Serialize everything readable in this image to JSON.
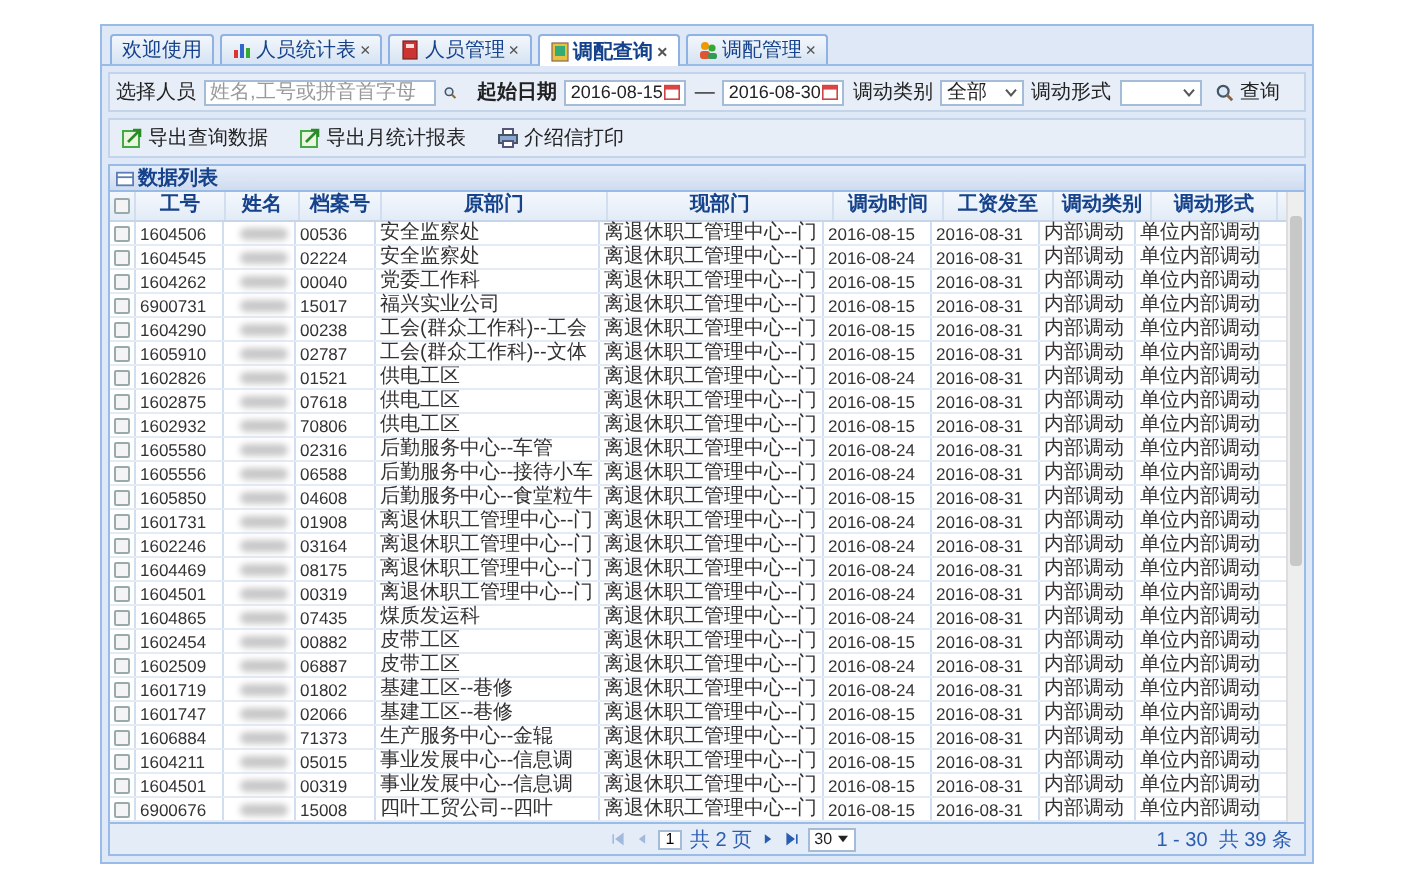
{
  "tabs": [
    {
      "label": "欢迎使用",
      "selected": false
    },
    {
      "label": "人员统计表",
      "close": "×",
      "selected": false
    },
    {
      "label": "人员管理",
      "close": "×",
      "selected": false
    },
    {
      "label": "调配查询",
      "close": "×",
      "selected": true
    },
    {
      "label": "调配管理",
      "close": "×",
      "selected": false
    }
  ],
  "filters": {
    "person_label": "选择人员",
    "person_placeholder": "姓名,工号或拼音首字母",
    "start_label": "起始日期",
    "start_date": "2016-08-15",
    "separator": "—",
    "end_date": "2016-08-30",
    "type_label": "调动类别",
    "type_value": "全部",
    "form_label": "调动形式",
    "query_button": "查询"
  },
  "actions": [
    {
      "label": "导出查询数据"
    },
    {
      "label": "导出月统计报表"
    },
    {
      "label": "介绍信打印"
    }
  ],
  "panel_title": "数据列表",
  "table": {
    "header_checked": false,
    "columns": [
      "工号",
      "姓名",
      "档案号",
      "原部门",
      "现部门",
      "调动时间",
      "工资发至",
      "调动类别",
      "调动形式"
    ],
    "rows": [
      {
        "checked": false,
        "cells": [
          "1604506",
          "",
          "00536",
          "安全监察处",
          "离退休职工管理中心--门",
          "2016-08-15",
          "2016-08-31",
          "内部调动",
          "单位内部调动"
        ]
      },
      {
        "checked": false,
        "cells": [
          "1604545",
          "",
          "02224",
          "安全监察处",
          "离退休职工管理中心--门",
          "2016-08-24",
          "2016-08-31",
          "内部调动",
          "单位内部调动"
        ]
      },
      {
        "checked": false,
        "cells": [
          "1604262",
          "",
          "00040",
          "党委工作科",
          "离退休职工管理中心--门",
          "2016-08-15",
          "2016-08-31",
          "内部调动",
          "单位内部调动"
        ]
      },
      {
        "checked": false,
        "cells": [
          "6900731",
          "",
          "15017",
          "福兴实业公司",
          "离退休职工管理中心--门",
          "2016-08-15",
          "2016-08-31",
          "内部调动",
          "单位内部调动"
        ]
      },
      {
        "checked": false,
        "cells": [
          "1604290",
          "",
          "00238",
          "工会(群众工作科)--工会",
          "离退休职工管理中心--门",
          "2016-08-15",
          "2016-08-31",
          "内部调动",
          "单位内部调动"
        ]
      },
      {
        "checked": false,
        "cells": [
          "1605910",
          "",
          "02787",
          "工会(群众工作科)--文体",
          "离退休职工管理中心--门",
          "2016-08-15",
          "2016-08-31",
          "内部调动",
          "单位内部调动"
        ]
      },
      {
        "checked": false,
        "cells": [
          "1602826",
          "",
          "01521",
          "供电工区",
          "离退休职工管理中心--门",
          "2016-08-24",
          "2016-08-31",
          "内部调动",
          "单位内部调动"
        ]
      },
      {
        "checked": false,
        "cells": [
          "1602875",
          "",
          "07618",
          "供电工区",
          "离退休职工管理中心--门",
          "2016-08-15",
          "2016-08-31",
          "内部调动",
          "单位内部调动"
        ]
      },
      {
        "checked": false,
        "cells": [
          "1602932",
          "",
          "70806",
          "供电工区",
          "离退休职工管理中心--门",
          "2016-08-15",
          "2016-08-31",
          "内部调动",
          "单位内部调动"
        ]
      },
      {
        "checked": false,
        "cells": [
          "1605580",
          "",
          "02316",
          "后勤服务中心--车管",
          "离退休职工管理中心--门",
          "2016-08-24",
          "2016-08-31",
          "内部调动",
          "单位内部调动"
        ]
      },
      {
        "checked": false,
        "cells": [
          "1605556",
          "",
          "06588",
          "后勤服务中心--接待小车",
          "离退休职工管理中心--门",
          "2016-08-24",
          "2016-08-31",
          "内部调动",
          "单位内部调动"
        ]
      },
      {
        "checked": false,
        "cells": [
          "1605850",
          "",
          "04608",
          "后勤服务中心--食堂粒牛",
          "离退休职工管理中心--门",
          "2016-08-15",
          "2016-08-31",
          "内部调动",
          "单位内部调动"
        ]
      },
      {
        "checked": false,
        "cells": [
          "1601731",
          "",
          "01908",
          "离退休职工管理中心--门",
          "离退休职工管理中心--门",
          "2016-08-24",
          "2016-08-31",
          "内部调动",
          "单位内部调动"
        ]
      },
      {
        "checked": false,
        "cells": [
          "1602246",
          "",
          "03164",
          "离退休职工管理中心--门",
          "离退休职工管理中心--门",
          "2016-08-24",
          "2016-08-31",
          "内部调动",
          "单位内部调动"
        ]
      },
      {
        "checked": false,
        "cells": [
          "1604469",
          "",
          "08175",
          "离退休职工管理中心--门",
          "离退休职工管理中心--门",
          "2016-08-24",
          "2016-08-31",
          "内部调动",
          "单位内部调动"
        ]
      },
      {
        "checked": false,
        "cells": [
          "1604501",
          "",
          "00319",
          "离退休职工管理中心--门",
          "离退休职工管理中心--门",
          "2016-08-24",
          "2016-08-31",
          "内部调动",
          "单位内部调动"
        ]
      },
      {
        "checked": false,
        "cells": [
          "1604865",
          "",
          "07435",
          "煤质发运科",
          "离退休职工管理中心--门",
          "2016-08-24",
          "2016-08-31",
          "内部调动",
          "单位内部调动"
        ]
      },
      {
        "checked": false,
        "cells": [
          "1602454",
          "",
          "00882",
          "皮带工区",
          "离退休职工管理中心--门",
          "2016-08-15",
          "2016-08-31",
          "内部调动",
          "单位内部调动"
        ]
      },
      {
        "checked": false,
        "cells": [
          "1602509",
          "",
          "06887",
          "皮带工区",
          "离退休职工管理中心--门",
          "2016-08-24",
          "2016-08-31",
          "内部调动",
          "单位内部调动"
        ]
      },
      {
        "checked": false,
        "cells": [
          "1601719",
          "",
          "01802",
          "基建工区--巷修",
          "离退休职工管理中心--门",
          "2016-08-24",
          "2016-08-31",
          "内部调动",
          "单位内部调动"
        ]
      },
      {
        "checked": false,
        "cells": [
          "1601747",
          "",
          "02066",
          "基建工区--巷修",
          "离退休职工管理中心--门",
          "2016-08-15",
          "2016-08-31",
          "内部调动",
          "单位内部调动"
        ]
      },
      {
        "checked": false,
        "cells": [
          "1606884",
          "",
          "71373",
          "生产服务中心--金辊",
          "离退休职工管理中心--门",
          "2016-08-15",
          "2016-08-31",
          "内部调动",
          "单位内部调动"
        ]
      },
      {
        "checked": false,
        "cells": [
          "1604211",
          "",
          "05015",
          "事业发展中心--信息调",
          "离退休职工管理中心--门",
          "2016-08-15",
          "2016-08-31",
          "内部调动",
          "单位内部调动"
        ]
      },
      {
        "checked": false,
        "cells": [
          "1604501",
          "",
          "00319",
          "事业发展中心--信息调",
          "离退休职工管理中心--门",
          "2016-08-15",
          "2016-08-31",
          "内部调动",
          "单位内部调动"
        ]
      },
      {
        "checked": false,
        "cells": [
          "6900676",
          "",
          "15008",
          "四叶工贸公司--四叶",
          "离退休职工管理中心--门",
          "2016-08-15",
          "2016-08-31",
          "内部调动",
          "单位内部调动"
        ]
      }
    ]
  },
  "pager": {
    "first_disabled": true,
    "prev_disabled": true,
    "page": "1",
    "pages_text": "共 2 页",
    "next_disabled": false,
    "last_disabled": false,
    "page_size": "30",
    "summary": "1 - 30  共 39 条"
  }
}
